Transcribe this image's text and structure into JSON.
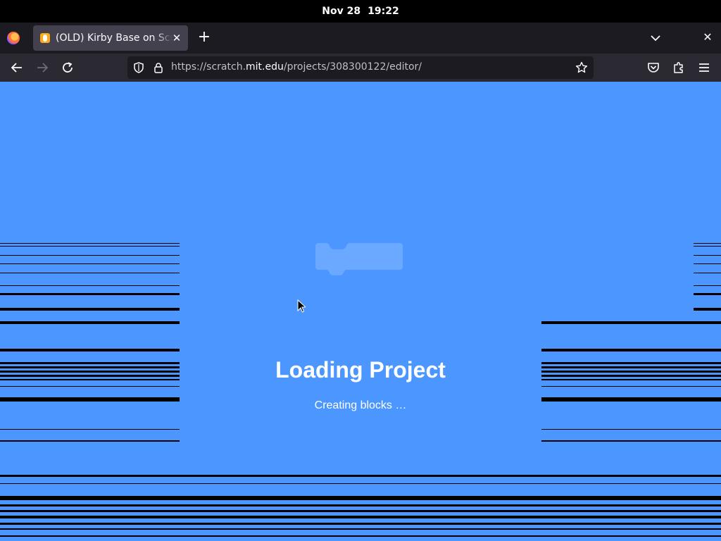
{
  "system": {
    "date": "Nov 28",
    "time": "19:22"
  },
  "browser": {
    "tab": {
      "title": "(OLD) Kirby Base on Scratch"
    },
    "url": {
      "prefix": "https://scratch.",
      "host": "mit.edu",
      "path": "/projects/308300122/editor/"
    }
  },
  "icons": [
    "firefox-logo-icon",
    "scratch-favicon-icon",
    "close-icon",
    "plus-icon",
    "chevron-down-icon",
    "back-arrow-icon",
    "forward-arrow-icon",
    "reload-icon",
    "shield-icon",
    "lock-icon",
    "star-icon",
    "pocket-icon",
    "extensions-icon",
    "menu-icon",
    "cursor-icon"
  ],
  "colors": {
    "stage_bg": "#4c97ff",
    "toolbar": "#2b2a33",
    "tabstrip": "#1c1b22"
  },
  "loader": {
    "title": "Loading Project",
    "message": "Creating blocks …"
  }
}
